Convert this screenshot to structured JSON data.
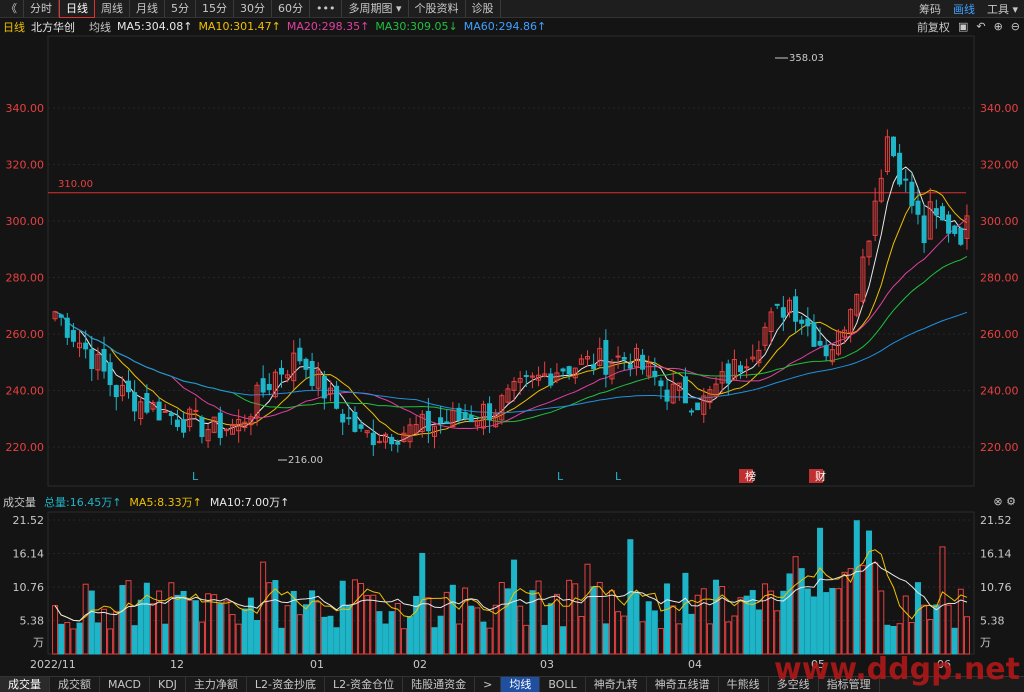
{
  "toolbar": {
    "back": "《",
    "items": [
      "分时",
      "日线",
      "周线",
      "月线",
      "5分",
      "15分",
      "30分",
      "60分",
      "•••",
      "多周期图 ▾",
      "个股资料",
      "诊股"
    ],
    "right": [
      "筹码",
      "画线",
      "工具 ▾"
    ]
  },
  "ma_bar": {
    "period": "日线",
    "name": "北方华创",
    "avg": "均线",
    "ma5": "MA5:304.08↑",
    "ma10": "MA10:301.47↑",
    "ma20": "MA20:298.35↑",
    "ma30": "MA30:309.05↓",
    "ma60": "MA60:294.86↑",
    "adjust": "前复权"
  },
  "vol_bar": {
    "title": "成交量",
    "total": "总量:16.45万↑",
    "ma5": "MA5:8.33万↑",
    "ma10": "MA10:7.00万↑"
  },
  "colors": {
    "up": "#e84040",
    "down": "#1fb5c8",
    "ma5": "#e8e8e8",
    "ma10": "#f0c000",
    "ma20": "#e040a0",
    "ma30": "#20c040",
    "ma60": "#2090e0",
    "ref": "#d83030"
  },
  "price_axis": {
    "labels": [
      "340.00",
      "320.00",
      "300.00",
      "280.00",
      "260.00",
      "240.00",
      "220.00"
    ]
  },
  "price_annotations": {
    "high": "358.03",
    "low": "216.00",
    "ref": "310.00"
  },
  "markers": [
    "L",
    "L",
    "L",
    "榜",
    "财"
  ],
  "vol_axis": {
    "labels": [
      "21.52",
      "16.14",
      "10.76",
      "5.38",
      "万"
    ]
  },
  "date_axis": {
    "labels": [
      "2022/11",
      "12",
      "01",
      "02",
      "03",
      "04",
      "05",
      "06"
    ]
  },
  "bottom_tabs": [
    "成交量",
    "成交额",
    "MACD",
    "KDJ",
    "主力净额",
    "L2-资金抄底",
    "L2-资金仓位",
    "陆股通资金",
    ">",
    "均线",
    "BOLL",
    "神奇九转",
    "神奇五线谱",
    "牛熊线",
    "多空线",
    "指标管理"
  ],
  "watermark": "www.ddgp.net"
}
